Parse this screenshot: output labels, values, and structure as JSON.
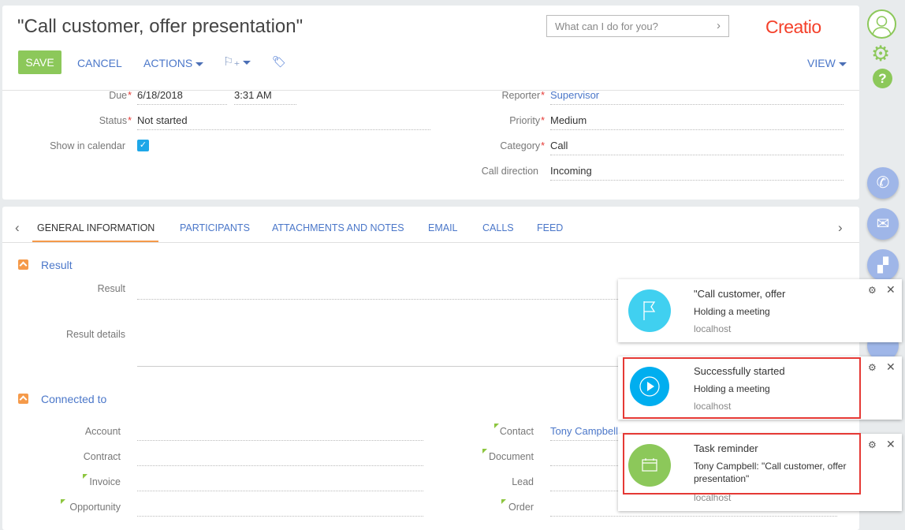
{
  "header": {
    "title": "\"Call customer, offer presentation\"",
    "search_placeholder": "What can I do for you?",
    "logo": "Creatio",
    "toolbar": {
      "save": "SAVE",
      "cancel": "CANCEL",
      "actions": "ACTIONS",
      "view": "VIEW"
    }
  },
  "fields": {
    "due": {
      "label": "Due",
      "date": "6/18/2018",
      "time": "3:31 AM"
    },
    "status": {
      "label": "Status",
      "value": "Not started"
    },
    "show_in_calendar": {
      "label": "Show in calendar",
      "checked": true
    },
    "reporter": {
      "label": "Reporter",
      "value": "Supervisor"
    },
    "priority": {
      "label": "Priority",
      "value": "Medium"
    },
    "category": {
      "label": "Category",
      "value": "Call"
    },
    "call_direction": {
      "label": "Call direction",
      "value": "Incoming"
    }
  },
  "tabs": [
    {
      "label": "GENERAL INFORMATION",
      "active": true
    },
    {
      "label": "PARTICIPANTS"
    },
    {
      "label": "ATTACHMENTS AND NOTES"
    },
    {
      "label": "EMAIL"
    },
    {
      "label": "CALLS"
    },
    {
      "label": "FEED"
    }
  ],
  "result_section": {
    "title": "Result",
    "result_label": "Result",
    "details_label": "Result details"
  },
  "connected_section": {
    "title": "Connected to",
    "left": [
      {
        "label": "Account",
        "value": ""
      },
      {
        "label": "Contract",
        "value": ""
      },
      {
        "label": "Invoice",
        "value": ""
      },
      {
        "label": "Opportunity",
        "value": ""
      }
    ],
    "right": [
      {
        "label": "Contact",
        "value": "Tony Campbell"
      },
      {
        "label": "Document",
        "value": ""
      },
      {
        "label": "Lead",
        "value": ""
      },
      {
        "label": "Order",
        "value": ""
      }
    ]
  },
  "notifications": [
    {
      "title": "\"Call customer, offer",
      "body": "Holding a meeting",
      "host": "localhost",
      "icon": "flag-icon",
      "color": "#40d0f0"
    },
    {
      "title": "Successfully started",
      "body": "Holding a meeting",
      "host": "localhost",
      "icon": "play-icon",
      "color": "#00aeef"
    },
    {
      "title": "Task reminder",
      "body": "Tony Campbell: \"Call customer, offer presentation\"",
      "host": "localhost",
      "icon": "calendar-icon",
      "color": "#8cc85a"
    }
  ],
  "colors": {
    "accent": "#4b77c9",
    "save": "#8cc85a",
    "logo": "#f4402a",
    "highlight": "#e53935"
  }
}
